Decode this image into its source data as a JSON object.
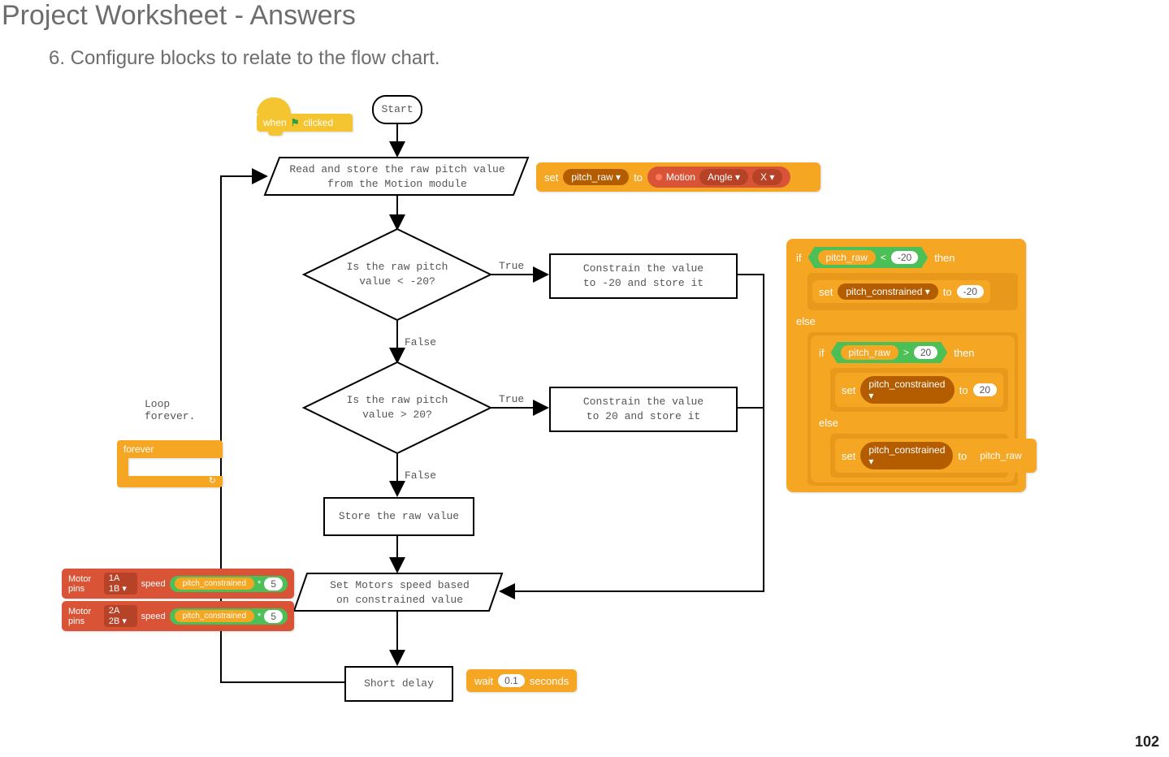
{
  "page": {
    "title": "Project Worksheet - Answers",
    "step": "6. Configure blocks to relate to the flow chart.",
    "number": "102"
  },
  "flow": {
    "start": "Start",
    "read": "Read and store the raw pitch value\nfrom the Motion module",
    "dec1": "Is the raw pitch\nvalue < -20?",
    "dec1_true": "True",
    "dec1_false": "False",
    "dec1_action": "Constrain the value\nto -20 and store it",
    "dec2": "Is the raw pitch\nvalue > 20?",
    "dec2_true": "True",
    "dec2_false": "False",
    "dec2_action": "Constrain the value\nto 20 and store it",
    "store_raw": "Store the raw value",
    "set_motors": "Set Motors speed based\non constrained value",
    "delay": "Short delay",
    "loop": "Loop\nforever."
  },
  "blocks": {
    "hat_when": "when",
    "hat_clicked": "clicked",
    "forever": "forever",
    "set": "set",
    "to": "to",
    "pitch_raw": "pitch_raw ▾",
    "motion": "Motion",
    "angle": "Angle ▾",
    "x": "X ▾",
    "if": "if",
    "then": "then",
    "else": "else",
    "lt": "<",
    "gt": ">",
    "neg20": "-20",
    "pos20": "20",
    "pitch_constrained": "pitch_constrained ▾",
    "pitch_constrained_plain": "pitch_constrained",
    "pitch_raw_plain": "pitch_raw",
    "motor_pins": "Motor pins",
    "pins1": "1A 1B ▾",
    "pins2": "2A 2B ▾",
    "speed": "speed",
    "mult": "*",
    "five": "5",
    "wait": "wait",
    "wait_val": "0.1",
    "seconds": "seconds"
  }
}
